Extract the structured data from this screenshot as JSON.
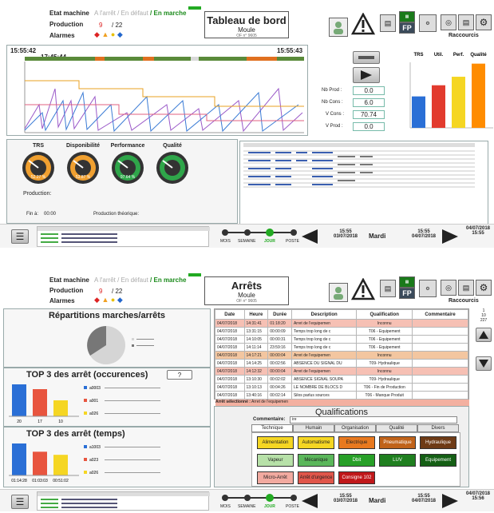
{
  "screen1": {
    "state_label": "Etat machine",
    "states": [
      "A l'arrêt",
      "/ En défaut",
      "/ En marche"
    ],
    "production_label": "Production",
    "production_value": "9",
    "production_total": "/ 22",
    "alarms_label": "Alarmes",
    "title": "Tableau de bord",
    "subtitle": "Moule",
    "of_label": "OF n° 9605",
    "fp_label": "FP",
    "shortcuts_label": "Raccourcis",
    "time_start": "15:55:42",
    "time_mark": "17:45:44",
    "time_end": "15:55:43",
    "fields": [
      {
        "label": "Nb Prod :",
        "value": "0.0"
      },
      {
        "label": "Nb Cons :",
        "value": "6.0"
      },
      {
        "label": "V Cons :",
        "value": "70.74"
      },
      {
        "label": "V Prod :",
        "value": "0.0"
      }
    ],
    "bars_chart_data": {
      "type": "bar",
      "categories": [
        "TRS",
        "Util.",
        "Perf.",
        "Qualité"
      ],
      "values": [
        48,
        65,
        78,
        98
      ],
      "colors": [
        "#2a6fd6",
        "#e23b2e",
        "#f5d623",
        "#ff8c00"
      ],
      "ylim": [
        0,
        100
      ]
    },
    "gauges": [
      {
        "label": "TRS",
        "value": "52.27 %",
        "color": "#f0a030"
      },
      {
        "label": "Disponibilité",
        "value": "53.87 %",
        "color": "#f0a030"
      },
      {
        "label": "Performance",
        "value": "97.64 %",
        "color": "#2fa64a"
      },
      {
        "label": "Qualité",
        "value": "",
        "color": "#2fa64a"
      }
    ],
    "production_text": "Production:",
    "end_label": "Fin à:",
    "end_value": "00:00",
    "theoretical_label": "Production théorique:",
    "nav": {
      "periods": [
        "MOIS",
        "SEMAINE",
        "JOUR",
        "POSTE"
      ],
      "left_time": "15:55",
      "left_date": "03/07/2018",
      "day": "Mardi",
      "mid_time": "15:55",
      "mid_date": "04/07/2018",
      "right_date": "04/07/2018",
      "right_time": "15:55"
    }
  },
  "screen2": {
    "title": "Arrêts",
    "subtitle": "Moule",
    "of_label": "OF n° 9605",
    "fp_label": "FP",
    "shortcuts_label": "Raccourcis",
    "repartition_title": "Répartitions marches/arrêts",
    "top_occ_title": "TOP 3 des arrêt (occurences)",
    "top_occ_btn": "?",
    "top_occ_chart": {
      "type": "bar",
      "categories": [
        "a0003",
        "a001",
        "a026"
      ],
      "values": [
        20,
        17,
        10
      ],
      "colors": [
        "#2a6fd6",
        "#e8553f",
        "#f5d623"
      ],
      "labels": [
        "20",
        "17",
        "10"
      ]
    },
    "top_time_title": "TOP 3 des arrêt (temps)",
    "top_time_chart": {
      "type": "bar",
      "categories": [
        "a1003",
        "a023",
        "a026"
      ],
      "values": [
        62,
        46,
        40
      ],
      "colors": [
        "#2a6fd6",
        "#e8553f",
        "#f5d623"
      ],
      "labels": [
        "01:14:28",
        "01:03:03",
        "00:51:02"
      ]
    },
    "table": {
      "headers": [
        "Date",
        "Heure",
        "Durée",
        "Description",
        "Qualification",
        "Commentaire"
      ],
      "rows": [
        {
          "cells": [
            "04/07/2018",
            "14:31:41",
            "01:18:20",
            "Arret de l'equipemen",
            "Inconnu",
            ""
          ],
          "hl": true
        },
        {
          "cells": [
            "04/07/2018",
            "13:31:15",
            "00:00:09",
            "Temps trop long de c",
            "T06 - Equipement",
            ""
          ],
          "hl": false
        },
        {
          "cells": [
            "04/07/2018",
            "14:10:05",
            "00:00:31",
            "Temps trop long de c",
            "T06 - Equipement",
            ""
          ],
          "hl": false
        },
        {
          "cells": [
            "04/07/2018",
            "14:11:14",
            "23:59:16",
            "Temps trop long de c",
            "T06 - Equipement",
            ""
          ],
          "hl": false
        },
        {
          "cells": [
            "04/07/2018",
            "14:17:21",
            "00:00:04",
            "Arret de l'equipemen",
            "Inconnu",
            ""
          ],
          "hl": true
        },
        {
          "cells": [
            "04/07/2018",
            "14:14:25",
            "00:02:56",
            "ABSENCE DU SIGNAL DU",
            "T09- Hydraulique",
            ""
          ],
          "hl": false
        },
        {
          "cells": [
            "04/07/2018",
            "14:12:32",
            "00:00:04",
            "Arret de l'equipemen",
            "Inconnu",
            ""
          ],
          "hl": true
        },
        {
          "cells": [
            "04/07/2018",
            "13:10:30",
            "00:02:02",
            "ABSENCE SIGNAL SOUPA",
            "T09- Hydraulique",
            ""
          ],
          "hl": false
        },
        {
          "cells": [
            "04/07/2018",
            "13:10:13",
            "00:04:26",
            "LE NOMBRE DE BLOCS D",
            "T06 - Fin de Production",
            ""
          ],
          "hl": false
        },
        {
          "cells": [
            "04/07/2018",
            "13:40:16",
            "00:02:14",
            "Silos parlus sources",
            "T06 - Manque Produit",
            ""
          ],
          "hl": false
        }
      ]
    },
    "pager": [
      "1",
      "10",
      "227"
    ],
    "selected_label": "Arrêt sélectionné :",
    "selected_value": "Arret de l'equipemen",
    "qual_title": "Qualifications",
    "comment_label": "Commentaire:",
    "comment_value": "ire",
    "tabs": [
      "Technique",
      "Humain",
      "Organisation",
      "Qualité",
      "Divers"
    ],
    "qual_buttons": [
      {
        "label": "Alimentation",
        "bg": "#f5d623",
        "fg": "#222"
      },
      {
        "label": "Automatisme",
        "bg": "#f5d623",
        "fg": "#222"
      },
      {
        "label": "Electrique",
        "bg": "#e8791f",
        "fg": "#222"
      },
      {
        "label": "Pneumatique",
        "bg": "#c0631a",
        "fg": "#fff"
      },
      {
        "label": "Hydraulique",
        "bg": "#6e3b16",
        "fg": "#fff"
      },
      {
        "label": "Vapeur",
        "bg": "#b7e1a8",
        "fg": "#222"
      },
      {
        "label": "Mécanique",
        "bg": "#5bb75b",
        "fg": "#222"
      },
      {
        "label": "Dbit",
        "bg": "#28a028",
        "fg": "#fff"
      },
      {
        "label": "LUV",
        "bg": "#1f7f1f",
        "fg": "#fff"
      },
      {
        "label": "Equipement",
        "bg": "#155f15",
        "fg": "#fff"
      },
      {
        "label": "Micro-Arrêt",
        "bg": "#f2aaa0",
        "fg": "#222"
      },
      {
        "label": "Arrêt d'urgence",
        "bg": "#e0564a",
        "fg": "#222"
      },
      {
        "label": "Consigne 102",
        "bg": "#c0181a",
        "fg": "#fff"
      }
    ],
    "nav": {
      "periods": [
        "MOIS",
        "SEMAINE",
        "JOUR",
        "POSTE"
      ],
      "left_time": "15:55",
      "left_date": "03/07/2018",
      "day": "Mardi",
      "mid_time": "15:55",
      "mid_date": "04/07/2018",
      "right_date": "04/07/2018",
      "right_time": "15:56"
    }
  }
}
